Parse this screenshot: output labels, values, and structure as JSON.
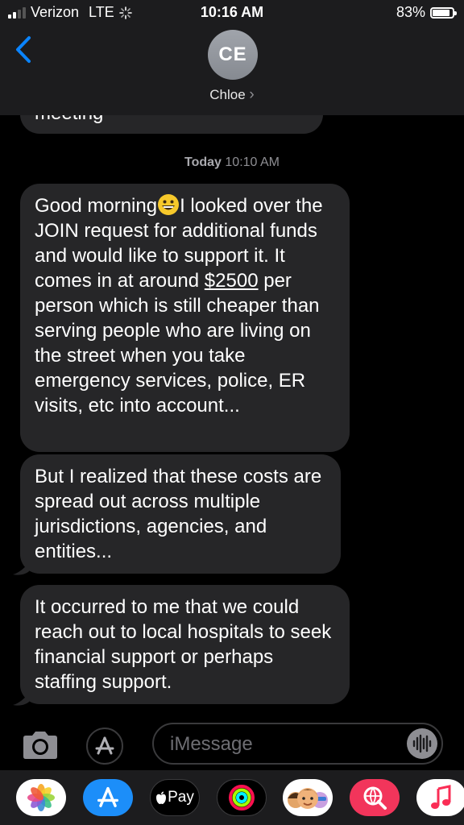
{
  "status_bar": {
    "carrier": "Verizon",
    "network": "LTE",
    "time": "10:16 AM",
    "battery": "83%",
    "battery_level": 0.83
  },
  "header": {
    "back_icon": "chevron-left-icon",
    "avatar_initials": "CE",
    "contact_name": "Chloe",
    "contact_chevron": "›"
  },
  "conversation": {
    "previous_message_fragment": "meeting",
    "timestamp_day": "Today",
    "timestamp_time": "10:10 AM",
    "messages": [
      {
        "parts": [
          "Good morning",
          "I looked over the JOIN request for additional funds and would like to support it. It comes in at around ",
          "$2500",
          " per person which is still cheaper than serving people who are living on the street when you take emergency services, police, ER visits, etc into account..."
        ],
        "emoji": "grinning-face-emoji"
      },
      {
        "text": "But I realized that these costs are spread out across multiple jurisdictions, agencies, and entities..."
      },
      {
        "text": "It occurred to me that we could reach out to local hospitals to seek financial support or perhaps staffing support."
      }
    ]
  },
  "input_bar": {
    "camera_icon": "camera-icon",
    "apps_icon": "app-store-icon",
    "placeholder": "iMessage",
    "audio_icon": "waveform-icon"
  },
  "app_drawer": {
    "apps": [
      {
        "name": "photos-app",
        "icon": "photos-icon"
      },
      {
        "name": "app-store-app",
        "icon": "app-store-icon"
      },
      {
        "name": "apple-pay-app",
        "label": "Pay",
        "icon": "apple-pay-icon"
      },
      {
        "name": "activity-app",
        "icon": "activity-rings-icon"
      },
      {
        "name": "memoji-app",
        "icon": "memoji-icon"
      },
      {
        "name": "search-images-app",
        "icon": "globe-search-icon"
      },
      {
        "name": "music-app",
        "icon": "music-note-icon"
      }
    ]
  },
  "colors": {
    "accent_blue": "#0a84ff",
    "bubble_gray": "#262628",
    "header_bg": "#1c1c1e"
  }
}
